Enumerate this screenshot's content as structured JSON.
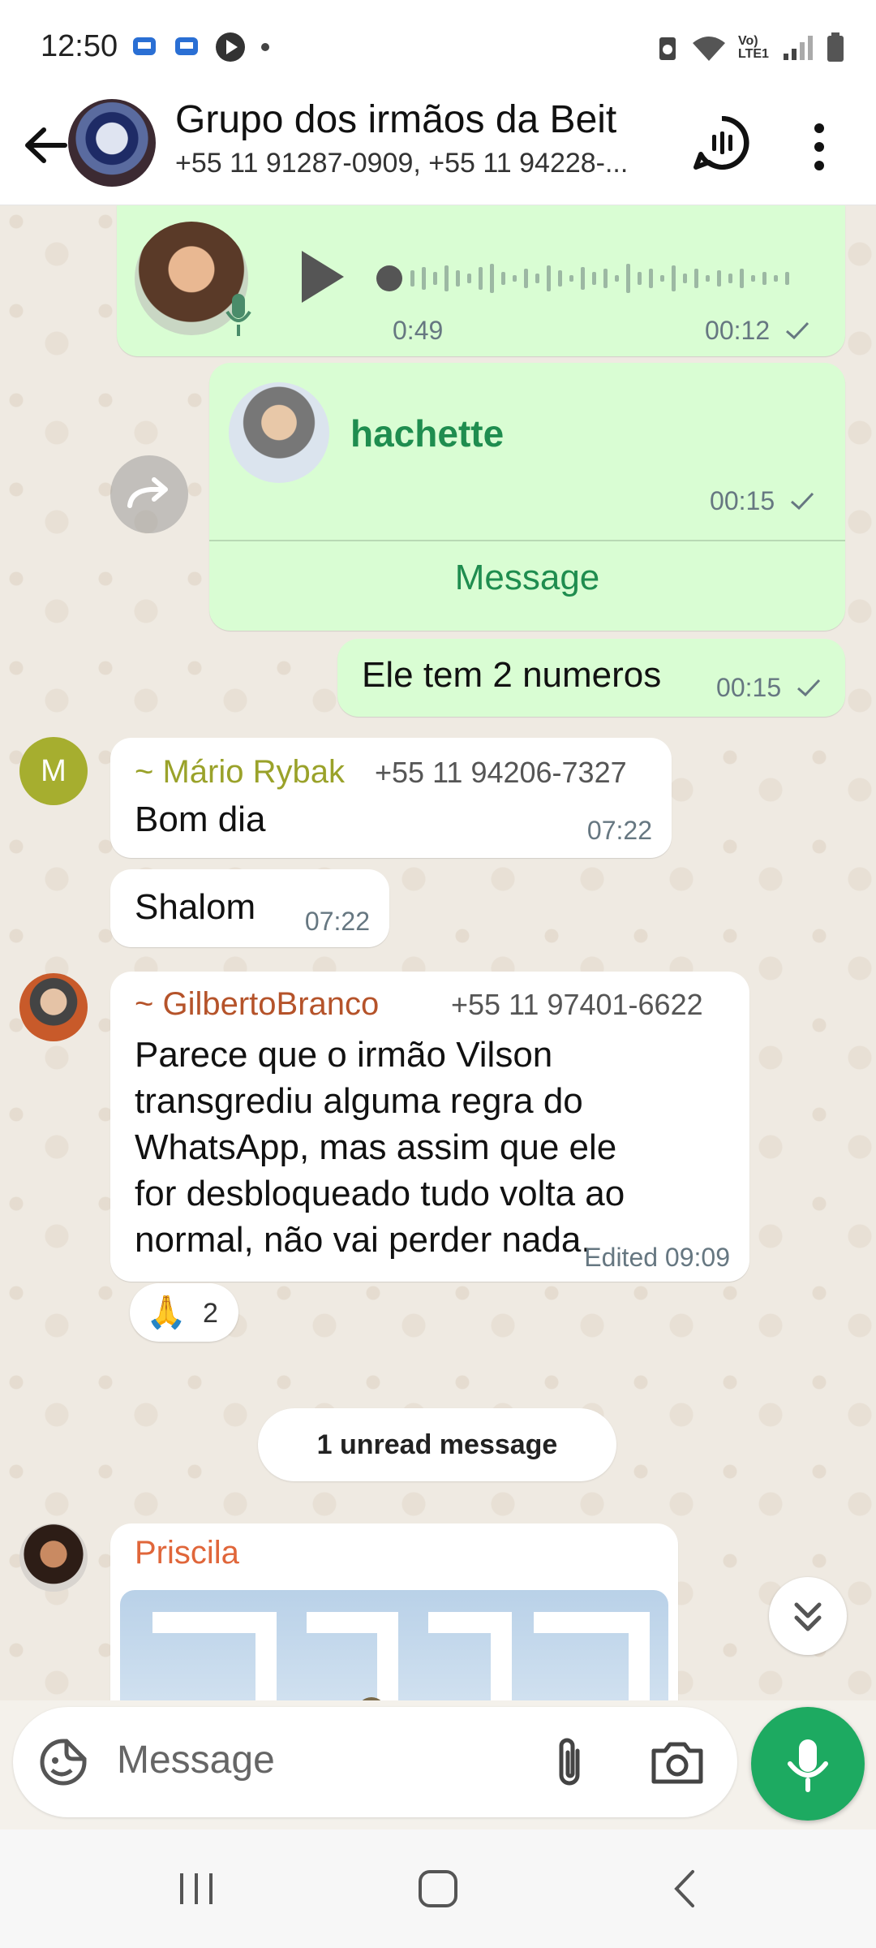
{
  "status_bar": {
    "time": "12:50",
    "network": "Vo) LTE1"
  },
  "header": {
    "title": "Grupo dos irmãos da Beit",
    "subtitle": "+55 11 91287-0909, +55 11 94228-..."
  },
  "messages": {
    "voice": {
      "duration": "0:49",
      "time": "00:12"
    },
    "contact_card": {
      "name": "hachette",
      "time": "00:15",
      "action": "Message"
    },
    "numbers": {
      "text": "Ele tem 2 numeros",
      "time": "00:15"
    },
    "mario": {
      "initial": "M",
      "sender": "~ Mário Rybak",
      "phone": "+55 11 94206-7327",
      "text": "Bom dia",
      "time": "07:22"
    },
    "shalom": {
      "text": "Shalom",
      "time": "07:22"
    },
    "gilberto": {
      "sender": "~ GilbertoBranco",
      "phone": "+55 11 97401-6622",
      "lines": [
        "Parece que o irmão Vilson",
        "transgrediu alguma regra do",
        "WhatsApp, mas assim que ele",
        "for desbloqueado tudo volta ao",
        "normal, não vai perder nada."
      ],
      "time": "Edited 09:09",
      "reaction_emoji": "🙏",
      "reaction_count": "2"
    },
    "unread": "1 unread message",
    "priscila": {
      "sender": "Priscila"
    }
  },
  "composer": {
    "placeholder": "Message"
  },
  "colors": {
    "accent_green": "#1daa61",
    "outgoing_bubble": "#d9fdd3",
    "mario_name": "#9aa22a",
    "gilberto_name": "#b5532a",
    "priscila_name": "#e0663a",
    "contact_name": "#1f8d4f"
  }
}
